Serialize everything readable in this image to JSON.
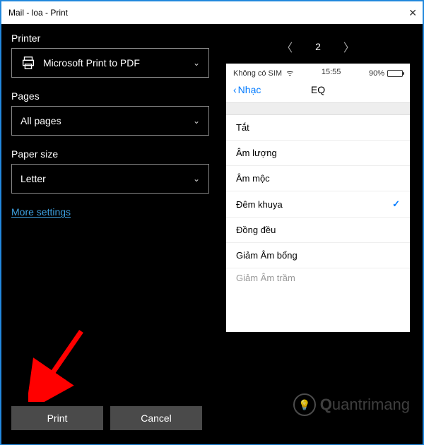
{
  "titlebar": {
    "title": "Mail - loa - Print"
  },
  "left": {
    "printer_label": "Printer",
    "printer_value": "Microsoft Print to PDF",
    "pages_label": "Pages",
    "pages_value": "All pages",
    "paper_label": "Paper size",
    "paper_value": "Letter",
    "more": "More settings"
  },
  "pager": {
    "current": "2"
  },
  "preview": {
    "carrier": "Không có SIM",
    "time": "15:55",
    "battery": "90%",
    "back": "Nhạc",
    "title": "EQ",
    "items": [
      "Tắt",
      "Âm lượng",
      "Âm mộc",
      "Đêm khuya",
      "Đồng đều",
      "Giảm Âm bổng",
      "Giảm Âm trầm"
    ],
    "selected_index": 3
  },
  "buttons": {
    "print": "Print",
    "cancel": "Cancel"
  },
  "watermark": {
    "text": "uantrimang"
  }
}
